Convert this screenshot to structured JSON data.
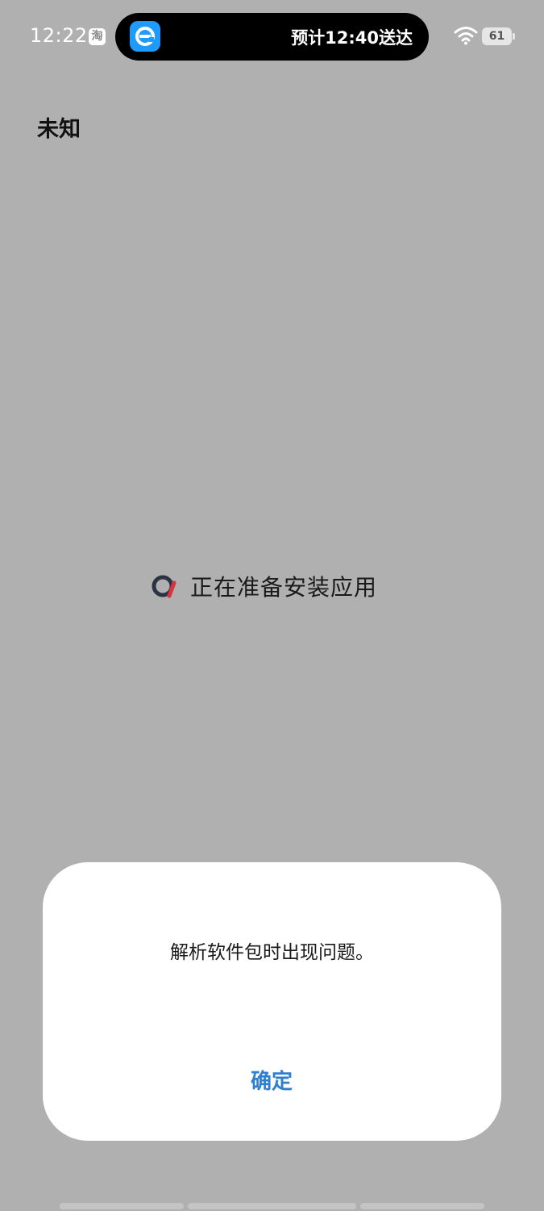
{
  "status_bar": {
    "time": "12:22",
    "notification_app_label": "淘",
    "live_activity": {
      "app_icon": "eleme-icon",
      "text": "预计12:40送达"
    },
    "wifi_icon": "wifi-icon",
    "battery_level": "61"
  },
  "page": {
    "title": "未知",
    "status_icon": "spinner-icon",
    "status_text": "正在准备安装应用"
  },
  "dialog": {
    "message": "解析软件包时出现问题。",
    "confirm_label": "确定"
  },
  "colors": {
    "background": "#b0b0b0",
    "accent": "#2f7fd1",
    "live_icon": "#1e9bff"
  }
}
